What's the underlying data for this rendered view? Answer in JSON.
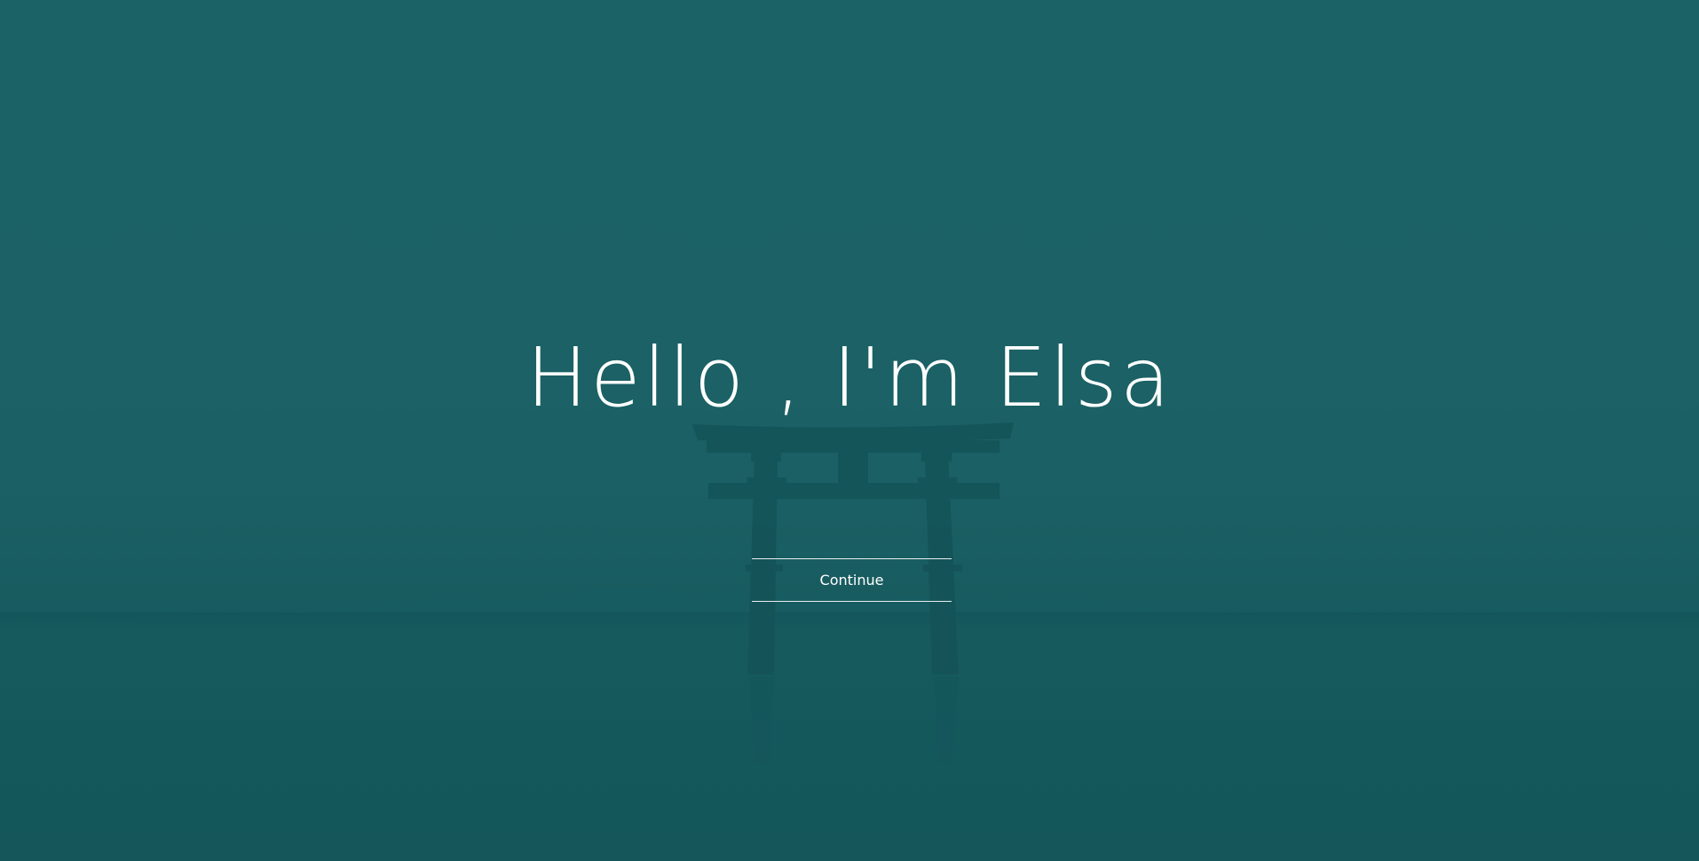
{
  "hero": {
    "headline": "Hello , I'm Elsa",
    "continue_label": "Continue",
    "background_image": "torii-gate-lake-icon",
    "colors": {
      "overlay": "#1b6266",
      "text": "#ffffff",
      "silhouette": "#0f5357"
    }
  }
}
